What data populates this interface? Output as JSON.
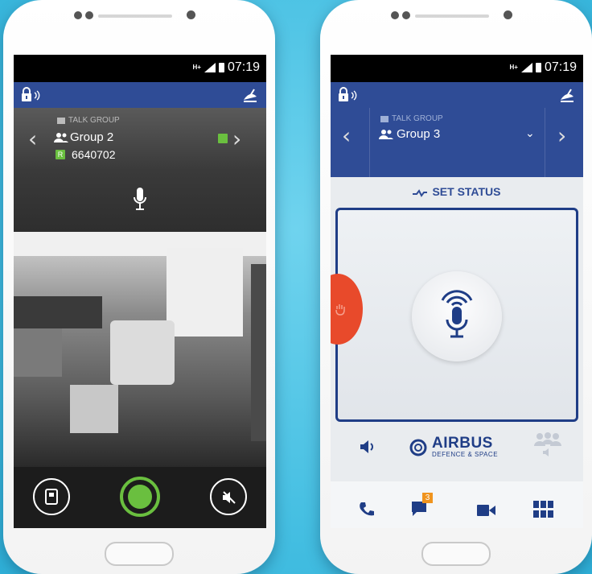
{
  "left_phone": {
    "status_bar": {
      "network": "H+",
      "time": "07:19"
    },
    "talk_group": {
      "label": "TALK GROUP",
      "group_name": "Group 2",
      "id_badge": "R",
      "id_number": "6640702"
    }
  },
  "right_phone": {
    "status_bar": {
      "network": "H+",
      "time": "07:19"
    },
    "talk_group": {
      "label": "TALK GROUP",
      "group_name": "Group 3"
    },
    "set_status": "SET STATUS",
    "brand": {
      "name": "AIRBUS",
      "subtitle": "DEFENCE & SPACE"
    },
    "nav": {
      "messages_badge": "3"
    }
  },
  "colors": {
    "background": "#45bfe2",
    "brand_blue": "#2f4c96",
    "accent_green": "#6abf3f",
    "alert_red": "#e84a2b",
    "badge_orange": "#f0941e"
  }
}
